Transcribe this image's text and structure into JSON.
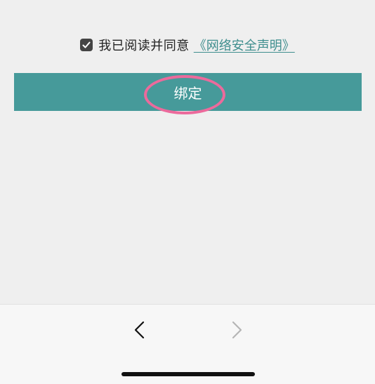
{
  "agreement": {
    "checked": true,
    "text": "我已阅读并同意",
    "link_text": "《网络安全声明》"
  },
  "bind_button": {
    "label": "绑定"
  },
  "navigation": {
    "back_icon": "chevron-left-icon",
    "forward_icon": "chevron-right-icon",
    "forward_enabled": false
  },
  "colors": {
    "accent": "#469a9a",
    "link": "#3f8e8e",
    "highlight": "#ec6a9c"
  }
}
